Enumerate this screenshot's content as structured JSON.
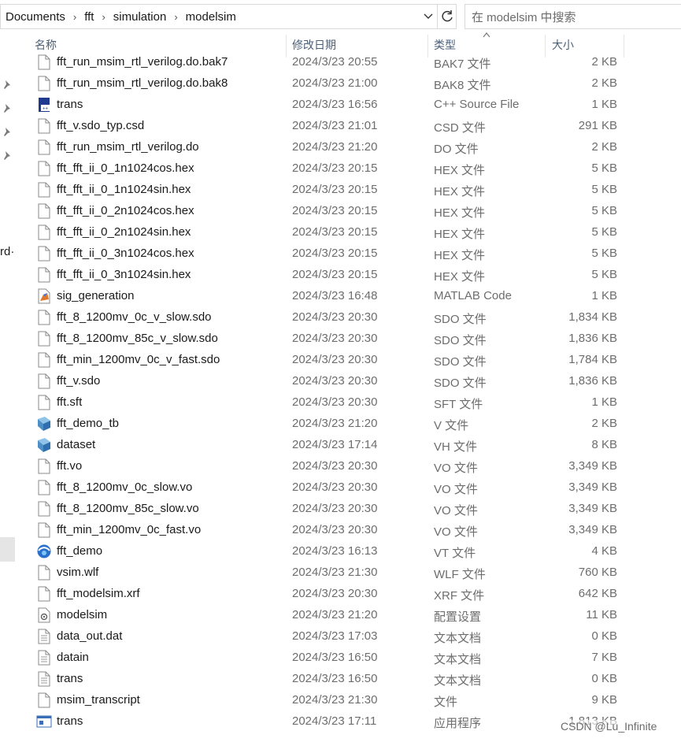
{
  "address_bar": {
    "breadcrumbs": [
      "Documents",
      "fft",
      "simulation",
      "modelsim"
    ]
  },
  "search": {
    "placeholder": "在 modelsim 中搜索"
  },
  "left_pane": {
    "partial_text": "rd·"
  },
  "columns": {
    "name": "名称",
    "date": "修改日期",
    "type": "类型",
    "size": "大小"
  },
  "files": [
    {
      "name": "fft_run_msim_rtl_verilog.do.bak7",
      "date": "2024/3/23 20:55",
      "type": "BAK7 文件",
      "size": "2 KB",
      "icon": "generic-file-icon"
    },
    {
      "name": "fft_run_msim_rtl_verilog.do.bak8",
      "date": "2024/3/23 21:00",
      "type": "BAK8 文件",
      "size": "2 KB",
      "icon": "generic-file-icon"
    },
    {
      "name": "trans",
      "date": "2024/3/23 16:56",
      "type": "C++ Source File",
      "size": "1 KB",
      "icon": "cpp-source-icon"
    },
    {
      "name": "fft_v.sdo_typ.csd",
      "date": "2024/3/23 21:01",
      "type": "CSD 文件",
      "size": "291 KB",
      "icon": "generic-file-icon"
    },
    {
      "name": "fft_run_msim_rtl_verilog.do",
      "date": "2024/3/23 21:20",
      "type": "DO 文件",
      "size": "2 KB",
      "icon": "generic-file-icon"
    },
    {
      "name": "fft_fft_ii_0_1n1024cos.hex",
      "date": "2024/3/23 20:15",
      "type": "HEX 文件",
      "size": "5 KB",
      "icon": "generic-file-icon"
    },
    {
      "name": "fft_fft_ii_0_1n1024sin.hex",
      "date": "2024/3/23 20:15",
      "type": "HEX 文件",
      "size": "5 KB",
      "icon": "generic-file-icon"
    },
    {
      "name": "fft_fft_ii_0_2n1024cos.hex",
      "date": "2024/3/23 20:15",
      "type": "HEX 文件",
      "size": "5 KB",
      "icon": "generic-file-icon"
    },
    {
      "name": "fft_fft_ii_0_2n1024sin.hex",
      "date": "2024/3/23 20:15",
      "type": "HEX 文件",
      "size": "5 KB",
      "icon": "generic-file-icon"
    },
    {
      "name": "fft_fft_ii_0_3n1024cos.hex",
      "date": "2024/3/23 20:15",
      "type": "HEX 文件",
      "size": "5 KB",
      "icon": "generic-file-icon"
    },
    {
      "name": "fft_fft_ii_0_3n1024sin.hex",
      "date": "2024/3/23 20:15",
      "type": "HEX 文件",
      "size": "5 KB",
      "icon": "generic-file-icon"
    },
    {
      "name": "sig_generation",
      "date": "2024/3/23 16:48",
      "type": "MATLAB Code",
      "size": "1 KB",
      "icon": "matlab-code-icon"
    },
    {
      "name": "fft_8_1200mv_0c_v_slow.sdo",
      "date": "2024/3/23 20:30",
      "type": "SDO 文件",
      "size": "1,834 KB",
      "icon": "generic-file-icon"
    },
    {
      "name": "fft_8_1200mv_85c_v_slow.sdo",
      "date": "2024/3/23 20:30",
      "type": "SDO 文件",
      "size": "1,836 KB",
      "icon": "generic-file-icon"
    },
    {
      "name": "fft_min_1200mv_0c_v_fast.sdo",
      "date": "2024/3/23 20:30",
      "type": "SDO 文件",
      "size": "1,784 KB",
      "icon": "generic-file-icon"
    },
    {
      "name": "fft_v.sdo",
      "date": "2024/3/23 20:30",
      "type": "SDO 文件",
      "size": "1,836 KB",
      "icon": "generic-file-icon"
    },
    {
      "name": "fft.sft",
      "date": "2024/3/23 20:30",
      "type": "SFT 文件",
      "size": "1 KB",
      "icon": "generic-file-icon"
    },
    {
      "name": "fft_demo_tb",
      "date": "2024/3/23 21:20",
      "type": "V 文件",
      "size": "2 KB",
      "icon": "verilog-file-icon"
    },
    {
      "name": "dataset",
      "date": "2024/3/23 17:14",
      "type": "VH 文件",
      "size": "8 KB",
      "icon": "verilog-file-icon"
    },
    {
      "name": "fft.vo",
      "date": "2024/3/23 20:30",
      "type": "VO 文件",
      "size": "3,349 KB",
      "icon": "generic-file-icon"
    },
    {
      "name": "fft_8_1200mv_0c_slow.vo",
      "date": "2024/3/23 20:30",
      "type": "VO 文件",
      "size": "3,349 KB",
      "icon": "generic-file-icon"
    },
    {
      "name": "fft_8_1200mv_85c_slow.vo",
      "date": "2024/3/23 20:30",
      "type": "VO 文件",
      "size": "3,349 KB",
      "icon": "generic-file-icon"
    },
    {
      "name": "fft_min_1200mv_0c_fast.vo",
      "date": "2024/3/23 20:30",
      "type": "VO 文件",
      "size": "3,349 KB",
      "icon": "generic-file-icon"
    },
    {
      "name": "fft_demo",
      "date": "2024/3/23 16:13",
      "type": "VT 文件",
      "size": "4 KB",
      "icon": "vt-file-icon"
    },
    {
      "name": "vsim.wlf",
      "date": "2024/3/23 21:30",
      "type": "WLF 文件",
      "size": "760 KB",
      "icon": "generic-file-icon"
    },
    {
      "name": "fft_modelsim.xrf",
      "date": "2024/3/23 20:30",
      "type": "XRF 文件",
      "size": "642 KB",
      "icon": "generic-file-icon"
    },
    {
      "name": "modelsim",
      "date": "2024/3/23 21:20",
      "type": "配置设置",
      "size": "11 KB",
      "icon": "config-settings-icon"
    },
    {
      "name": "data_out.dat",
      "date": "2024/3/23 17:03",
      "type": "文本文档",
      "size": "0 KB",
      "icon": "text-document-icon"
    },
    {
      "name": "datain",
      "date": "2024/3/23 16:50",
      "type": "文本文档",
      "size": "7 KB",
      "icon": "text-document-icon"
    },
    {
      "name": "trans",
      "date": "2024/3/23 16:50",
      "type": "文本文档",
      "size": "0 KB",
      "icon": "text-document-icon"
    },
    {
      "name": "msim_transcript",
      "date": "2024/3/23 21:30",
      "type": "文件",
      "size": "9 KB",
      "icon": "generic-file-icon"
    },
    {
      "name": "trans",
      "date": "2024/3/23 17:11",
      "type": "应用程序",
      "size": "1,813 KB",
      "icon": "application-icon"
    }
  ],
  "watermark": "CSDN @Lu_Infinite"
}
